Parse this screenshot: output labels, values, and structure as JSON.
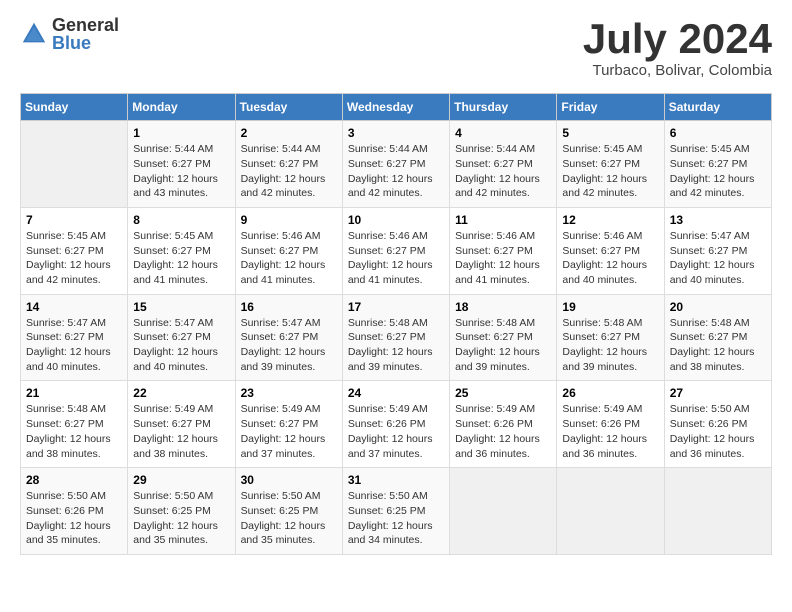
{
  "logo": {
    "general": "General",
    "blue": "Blue"
  },
  "title": "July 2024",
  "location": "Turbaco, Bolivar, Colombia",
  "days_of_week": [
    "Sunday",
    "Monday",
    "Tuesday",
    "Wednesday",
    "Thursday",
    "Friday",
    "Saturday"
  ],
  "weeks": [
    [
      {
        "num": "",
        "info": ""
      },
      {
        "num": "1",
        "info": "Sunrise: 5:44 AM\nSunset: 6:27 PM\nDaylight: 12 hours\nand 43 minutes."
      },
      {
        "num": "2",
        "info": "Sunrise: 5:44 AM\nSunset: 6:27 PM\nDaylight: 12 hours\nand 42 minutes."
      },
      {
        "num": "3",
        "info": "Sunrise: 5:44 AM\nSunset: 6:27 PM\nDaylight: 12 hours\nand 42 minutes."
      },
      {
        "num": "4",
        "info": "Sunrise: 5:44 AM\nSunset: 6:27 PM\nDaylight: 12 hours\nand 42 minutes."
      },
      {
        "num": "5",
        "info": "Sunrise: 5:45 AM\nSunset: 6:27 PM\nDaylight: 12 hours\nand 42 minutes."
      },
      {
        "num": "6",
        "info": "Sunrise: 5:45 AM\nSunset: 6:27 PM\nDaylight: 12 hours\nand 42 minutes."
      }
    ],
    [
      {
        "num": "7",
        "info": "Sunrise: 5:45 AM\nSunset: 6:27 PM\nDaylight: 12 hours\nand 42 minutes."
      },
      {
        "num": "8",
        "info": "Sunrise: 5:45 AM\nSunset: 6:27 PM\nDaylight: 12 hours\nand 41 minutes."
      },
      {
        "num": "9",
        "info": "Sunrise: 5:46 AM\nSunset: 6:27 PM\nDaylight: 12 hours\nand 41 minutes."
      },
      {
        "num": "10",
        "info": "Sunrise: 5:46 AM\nSunset: 6:27 PM\nDaylight: 12 hours\nand 41 minutes."
      },
      {
        "num": "11",
        "info": "Sunrise: 5:46 AM\nSunset: 6:27 PM\nDaylight: 12 hours\nand 41 minutes."
      },
      {
        "num": "12",
        "info": "Sunrise: 5:46 AM\nSunset: 6:27 PM\nDaylight: 12 hours\nand 40 minutes."
      },
      {
        "num": "13",
        "info": "Sunrise: 5:47 AM\nSunset: 6:27 PM\nDaylight: 12 hours\nand 40 minutes."
      }
    ],
    [
      {
        "num": "14",
        "info": "Sunrise: 5:47 AM\nSunset: 6:27 PM\nDaylight: 12 hours\nand 40 minutes."
      },
      {
        "num": "15",
        "info": "Sunrise: 5:47 AM\nSunset: 6:27 PM\nDaylight: 12 hours\nand 40 minutes."
      },
      {
        "num": "16",
        "info": "Sunrise: 5:47 AM\nSunset: 6:27 PM\nDaylight: 12 hours\nand 39 minutes."
      },
      {
        "num": "17",
        "info": "Sunrise: 5:48 AM\nSunset: 6:27 PM\nDaylight: 12 hours\nand 39 minutes."
      },
      {
        "num": "18",
        "info": "Sunrise: 5:48 AM\nSunset: 6:27 PM\nDaylight: 12 hours\nand 39 minutes."
      },
      {
        "num": "19",
        "info": "Sunrise: 5:48 AM\nSunset: 6:27 PM\nDaylight: 12 hours\nand 39 minutes."
      },
      {
        "num": "20",
        "info": "Sunrise: 5:48 AM\nSunset: 6:27 PM\nDaylight: 12 hours\nand 38 minutes."
      }
    ],
    [
      {
        "num": "21",
        "info": "Sunrise: 5:48 AM\nSunset: 6:27 PM\nDaylight: 12 hours\nand 38 minutes."
      },
      {
        "num": "22",
        "info": "Sunrise: 5:49 AM\nSunset: 6:27 PM\nDaylight: 12 hours\nand 38 minutes."
      },
      {
        "num": "23",
        "info": "Sunrise: 5:49 AM\nSunset: 6:27 PM\nDaylight: 12 hours\nand 37 minutes."
      },
      {
        "num": "24",
        "info": "Sunrise: 5:49 AM\nSunset: 6:26 PM\nDaylight: 12 hours\nand 37 minutes."
      },
      {
        "num": "25",
        "info": "Sunrise: 5:49 AM\nSunset: 6:26 PM\nDaylight: 12 hours\nand 36 minutes."
      },
      {
        "num": "26",
        "info": "Sunrise: 5:49 AM\nSunset: 6:26 PM\nDaylight: 12 hours\nand 36 minutes."
      },
      {
        "num": "27",
        "info": "Sunrise: 5:50 AM\nSunset: 6:26 PM\nDaylight: 12 hours\nand 36 minutes."
      }
    ],
    [
      {
        "num": "28",
        "info": "Sunrise: 5:50 AM\nSunset: 6:26 PM\nDaylight: 12 hours\nand 35 minutes."
      },
      {
        "num": "29",
        "info": "Sunrise: 5:50 AM\nSunset: 6:25 PM\nDaylight: 12 hours\nand 35 minutes."
      },
      {
        "num": "30",
        "info": "Sunrise: 5:50 AM\nSunset: 6:25 PM\nDaylight: 12 hours\nand 35 minutes."
      },
      {
        "num": "31",
        "info": "Sunrise: 5:50 AM\nSunset: 6:25 PM\nDaylight: 12 hours\nand 34 minutes."
      },
      {
        "num": "",
        "info": ""
      },
      {
        "num": "",
        "info": ""
      },
      {
        "num": "",
        "info": ""
      }
    ]
  ]
}
